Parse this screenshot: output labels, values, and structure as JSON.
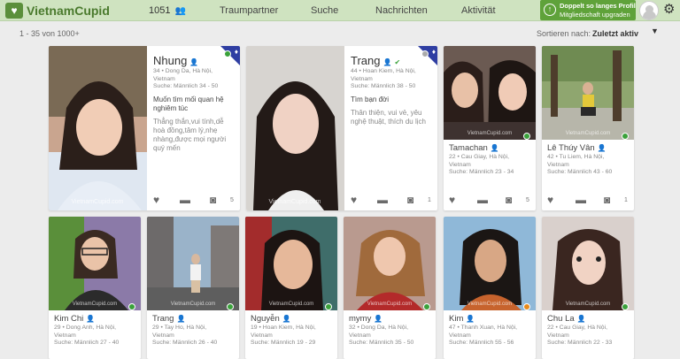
{
  "header": {
    "logo_text": "VietnamCupid",
    "counter": "1051",
    "nav": [
      "Traumpartner",
      "Suche",
      "Nachrichten",
      "Aktivität"
    ],
    "upgrade_line1": "Doppelt so langes Profil",
    "upgrade_line2": "Mitgliedschaft upgraden"
  },
  "toolbar": {
    "results": "1 - 35 von 1000+",
    "sort_label": "Sortieren nach:",
    "sort_value": "Zuletzt aktiv"
  },
  "watermark": "VietnamCupid.com",
  "featured": [
    {
      "name": "Nhung",
      "info": [
        "34 • Dong Da, Hà Nội,",
        "Vietnam",
        "Suche: Männlich 34 - 50"
      ],
      "quote": "Muốn tìm mối quan hệ nghiêm túc",
      "desc": "Thẳng thắn,vui tính,dễ hoà đồng,tâm lý,nhẹ nhàng,được mọi người quý mến",
      "photos": "5",
      "status_color": "#3aa13a"
    },
    {
      "name": "Trang",
      "info": [
        "44 • Hoan Kiem, Hà Nội,",
        "Vietnam",
        "Suche: Männlich 38 - 50"
      ],
      "quote": "Tìm bạn đời",
      "desc": "Thân thiện, vui vẻ, yêu nghệ thuật, thích du lịch",
      "photos": "1",
      "status_color": "#aaaaaa"
    }
  ],
  "row1": [
    {
      "name": "Tamachan",
      "info": [
        "22 • Cau Giay, Hà Nội,",
        "Vietnam",
        "Suche: Männlich 23 - 34"
      ],
      "photos": "5",
      "status_color": "#3aa13a"
    },
    {
      "name": "Lê Thúy Vân",
      "info": [
        "42 • Tu Liem, Hà Nội,",
        "Vietnam",
        "Suche: Männlich 43 - 60"
      ],
      "photos": "1",
      "status_color": "#3aa13a"
    }
  ],
  "row2": [
    {
      "name": "Kim Chi",
      "info": [
        "29 • Dong Anh, Hà Nội,",
        "Vietnam",
        "Suche: Männlich 27 - 40"
      ],
      "status_color": "#3aa13a"
    },
    {
      "name": "Trang",
      "info": [
        "29 • Tay Ho, Hà Nội,",
        "Vietnam",
        "Suche: Männlich 26 - 40"
      ],
      "status_color": "#3aa13a"
    },
    {
      "name": "Nguyễn",
      "info": [
        "19 • Hoan Kiem, Hà Nội,",
        "Vietnam",
        "Suche: Männlich 19 - 29"
      ],
      "status_color": "#3aa13a"
    },
    {
      "name": "mymy",
      "info": [
        "32 • Dong Da, Hà Nội,",
        "Vietnam",
        "Suche: Männlich 35 - 50"
      ],
      "status_color": "#3aa13a"
    },
    {
      "name": "Kim",
      "info": [
        "47 • Thanh Xuan, Hà Nội,",
        "Vietnam",
        "Suche: Männlich 55 - 56"
      ],
      "status_color": "#e88a1a"
    },
    {
      "name": "Chu La",
      "info": [
        "22 • Cau Giay, Hà Nội,",
        "Vietnam",
        "Suche: Männlich 22 - 33"
      ],
      "status_color": "#3aa13a"
    }
  ],
  "colors": {
    "brand": "#5b8f3b",
    "topbar": "#cfe3c0",
    "upgrade": "#5fa23a",
    "online": "#3aa13a"
  }
}
